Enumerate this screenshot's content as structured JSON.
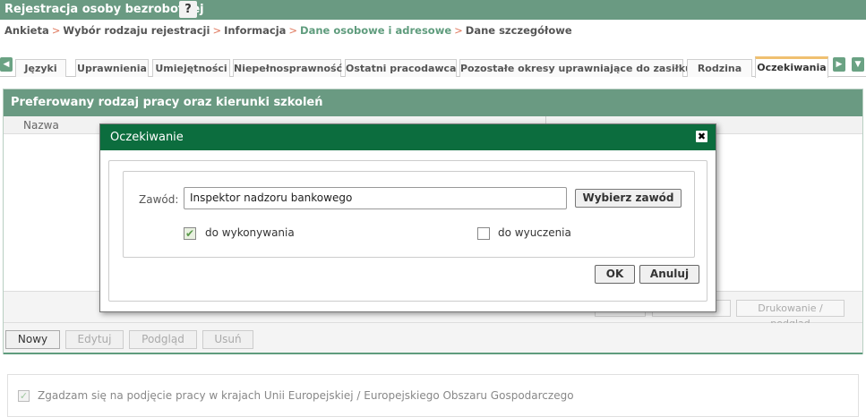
{
  "app": {
    "title": "Rejestracja osoby bezrobotnej",
    "help_icon": "?"
  },
  "breadcrumb": [
    "Ankieta",
    "Wybór rodzaju rejestracji",
    "Informacja",
    "Dane osobowe i adresowe",
    "Dane szczegółowe"
  ],
  "tabs": [
    "Języki",
    "Uprawnienia",
    "Umiejętności",
    "Niepełnosprawność",
    "Ostatni pracodawca",
    "Pozostałe okresy uprawniające do zasiłku",
    "Rodzina",
    "Oczekiwania"
  ],
  "active_tab": "Oczekiwania",
  "panel": {
    "title": "Preferowany rodzaj pracy oraz kierunki szkoleń",
    "column_name": "Nazwa",
    "print_button": "Drukowanie / podgląd",
    "buttons": {
      "new": "Nowy",
      "edit": "Edytuj",
      "preview": "Podgląd",
      "delete": "Usuń"
    }
  },
  "eu_consent": {
    "label": "Zgadzam się na podjęcie pracy w krajach Unii Europejskiej / Europejskiego Obszaru Gospodarczego",
    "checked": true
  },
  "dialog": {
    "title": "Oczekiwanie",
    "close_icon": "✖",
    "occupation_label": "Zawód:",
    "occupation_value": "Inspektor nadzoru bankowego",
    "choose_button": "Wybierz zawód",
    "option_work": {
      "label": "do wykonywania",
      "checked": true
    },
    "option_learn": {
      "label": "do wyuczenia",
      "checked": false
    },
    "ok_button": "OK",
    "cancel_button": "Anuluj"
  },
  "colors": {
    "accent": "#6a9a82",
    "dialog_header": "#0c6d3e",
    "breadcrumb_sep": "#e07a5f"
  }
}
